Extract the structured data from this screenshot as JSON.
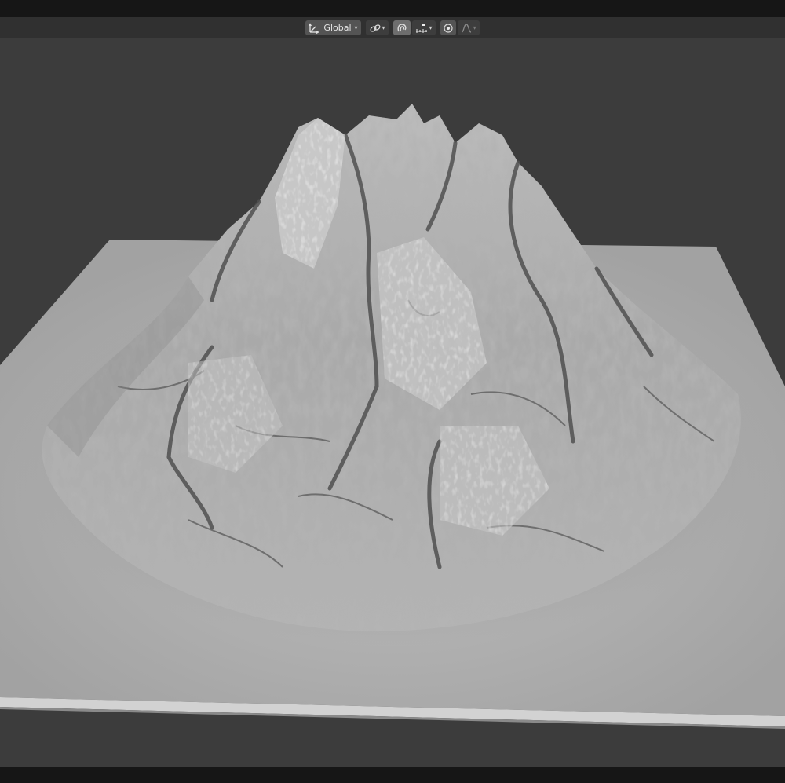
{
  "header": {
    "pivot": {
      "icon": "transform-pivot-icon",
      "label": "Global"
    },
    "snap": {
      "link_icon": "link-icon",
      "magnet_icon": "snap-magnet-icon",
      "increment_icon": "snap-increment-icon"
    },
    "proportional": {
      "toggle_icon": "proportional-edit-icon",
      "falloff_icon": "falloff-curve-icon"
    }
  },
  "scene": {
    "plane_color": "#a5a5a5",
    "plane_edge_color": "#d8d8d8",
    "mountain_light": "#c8c8c8",
    "mountain_dark": "#6a6a6a",
    "viewport_bg": "#3c3c3c"
  }
}
